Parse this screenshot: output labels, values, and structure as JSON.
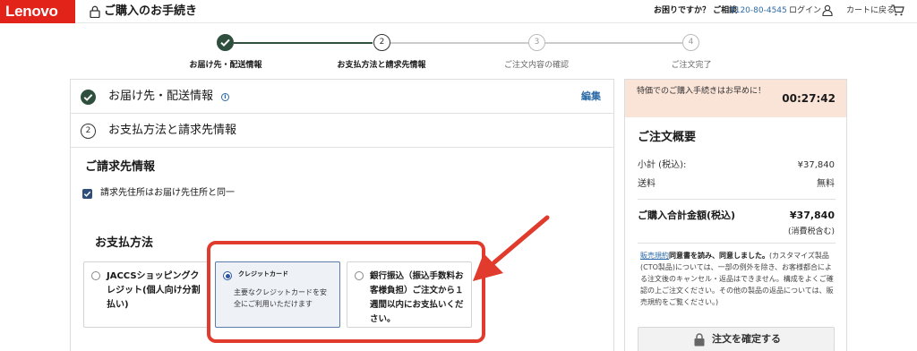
{
  "header": {
    "logo": "Lenovo",
    "title": "ご購入のお手続き",
    "help_text": "お困りですか？ ご相談",
    "help_phone": "0120-80-4545",
    "login": "ログイン",
    "back_to_cart": "カートに戻る",
    "icons": [
      "lock-icon",
      "user-icon",
      "cart-icon"
    ]
  },
  "stepper": {
    "steps": [
      {
        "number": "1",
        "label": "お届け先・配送情報",
        "state": "completed"
      },
      {
        "number": "2",
        "label": "お支払方法と請求先情報",
        "state": "current"
      },
      {
        "number": "3",
        "label": "ご注文内容の確認",
        "state": "upcoming"
      },
      {
        "number": "4",
        "label": "ご注文完了",
        "state": "upcoming"
      }
    ]
  },
  "checkout": {
    "shipping_section": {
      "title": "お届け先・配送情報",
      "info_icon": "i",
      "edit": "編集"
    },
    "payment_section": {
      "number": "2",
      "title": "お支払方法と請求先情報"
    },
    "billing": {
      "heading": "ご請求先情報",
      "same_as_shipping": "請求先住所はお届け先住所と同一",
      "same_as_shipping_checked": true
    },
    "payment_method": {
      "heading": "お支払方法",
      "options": [
        {
          "title": "JACCSショッピングクレジット(個人向け分割払い)",
          "selected": false
        },
        {
          "title": "クレジットカード",
          "description": "主要なクレジットカードを安全にご利用いただけます",
          "selected": true
        },
        {
          "title": "銀行振込（振込手数料お客様負担）ご注文から１週間以内にお支払いください。",
          "selected": false
        }
      ]
    }
  },
  "order_summary": {
    "timer_text": "特価でのご購入手続きはお早めに！",
    "timer_value": "00:27:42",
    "title": "ご注文概要",
    "subtotal_label": "小計 (税込):",
    "subtotal_value": "¥37,840",
    "shipping_label": "送料",
    "shipping_value": "無料",
    "total_label": "ご購入合計金額(税込)",
    "total_value": "¥37,840",
    "tax_note": "(消費税含む)",
    "terms_link": "販売規約",
    "terms_agree": "同意書を読み、同意しました。",
    "terms_body": "(カスタマイズ製品(CTO製品)については、一部の例外を除き、お客様都合による注文後のキャンセル・返品はできません。構成をよくご確認の上ご注文ください。その他の製品の返品については、販売規約をご覧ください。)",
    "confirm_button": "注文を確定する"
  },
  "colors": {
    "brand": "#e2231a",
    "step_complete": "#2f4f3e",
    "link": "#2b6aa6",
    "timer_bg": "#fae3d7",
    "annotation": "#e03b2c"
  }
}
